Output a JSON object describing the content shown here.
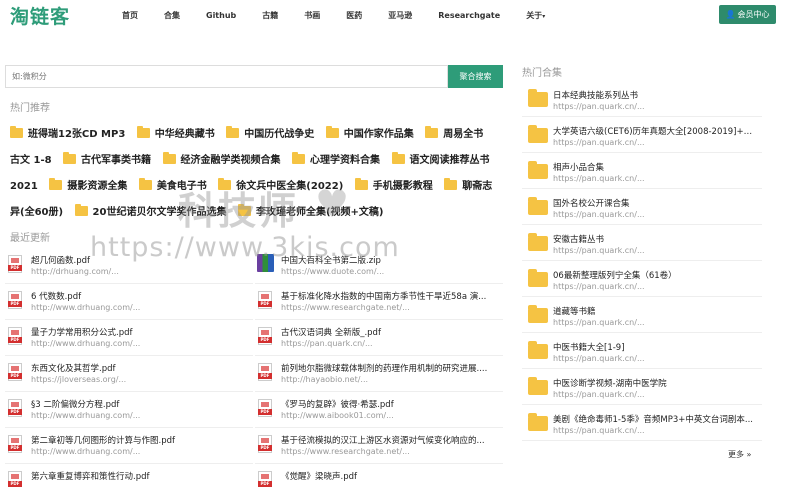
{
  "header": {
    "logo": "淘链客",
    "nav": [
      {
        "label": "首页"
      },
      {
        "label": "合集"
      },
      {
        "label": "Github"
      },
      {
        "label": "古籍"
      },
      {
        "label": "书画"
      },
      {
        "label": "医药"
      },
      {
        "label": "亚马逊"
      },
      {
        "label": "Researchgate"
      },
      {
        "label": "关于"
      }
    ],
    "vip_label": "会员中心"
  },
  "search": {
    "placeholder": "如:微积分",
    "button_label": "聚合搜索"
  },
  "hot_recommend": {
    "title": "热门推荐",
    "tags": [
      "班得瑞12张CD MP3",
      "中华经典藏书",
      "中国历代战争史",
      "中国作家作品集",
      "周易全书 古文 1-8",
      "古代军事类书籍",
      "经济金融学类视频合集",
      "心理学资料合集",
      "语文阅读推荐丛书2021",
      "摄影资源全集",
      "美食电子书",
      "徐文兵中医全集(2022)",
      "手机摄影教程",
      "聊斋志异(全60册)",
      "20世纪诺贝尔文学奖作品选集",
      "李玫瑾老师全集(视频+文稿)"
    ]
  },
  "recent": {
    "title": "最近更新",
    "items": [
      {
        "name": "超几何函数.pdf",
        "url": "http://drhuang.com/...",
        "type": "pdf"
      },
      {
        "name": "中国大百科全书第二版.zip",
        "url": "https://www.duote.com/...",
        "type": "zip"
      },
      {
        "name": "6 代数数.pdf",
        "url": "http://www.drhuang.com/...",
        "type": "pdf"
      },
      {
        "name": "基于标准化降水指数的中国南方季节性干旱近58a 演...",
        "url": "https://www.researchgate.net/...",
        "type": "pdf"
      },
      {
        "name": "量子力学常用积分公式.pdf",
        "url": "http://www.drhuang.com/...",
        "type": "pdf"
      },
      {
        "name": "古代汉语词典 全新版_.pdf",
        "url": "https://pan.quark.cn/...",
        "type": "pdf"
      },
      {
        "name": "东西文化及其哲学.pdf",
        "url": "https://jloverseas.org/...",
        "type": "pdf"
      },
      {
        "name": "前列地尔脂微球载体制剂的药理作用机制的研究进展....",
        "url": "http://hayaobio.net/...",
        "type": "pdf"
      },
      {
        "name": "§3 二阶偏微分方程.pdf",
        "url": "http://www.drhuang.com/...",
        "type": "pdf"
      },
      {
        "name": "《罗马的复辟》彼得·希瑟.pdf",
        "url": "http://www.aibook01.com/...",
        "type": "pdf"
      },
      {
        "name": "第二章初等几何图形的计算与作图.pdf",
        "url": "http://www.drhuang.com/...",
        "type": "pdf"
      },
      {
        "name": "基于径流模拟的汉江上游区水资源对气候变化响应的...",
        "url": "https://www.researchgate.net/...",
        "type": "pdf"
      },
      {
        "name": "第六章重复博弈和策性行动.pdf",
        "url": "",
        "type": "pdf"
      },
      {
        "name": "《觉醒》梁晓声.pdf",
        "url": "",
        "type": "pdf"
      }
    ]
  },
  "hot_collections": {
    "title": "热门合集",
    "items": [
      {
        "name": "日本经典技能系列丛书",
        "url": "https://pan.quark.cn/..."
      },
      {
        "name": "大学英语六级(CET6)历年真题大全[2008-2019]+真...",
        "url": "https://pan.quark.cn/..."
      },
      {
        "name": "相声小品合集",
        "url": "https://pan.quark.cn/..."
      },
      {
        "name": "国外名校公开课合集",
        "url": "https://pan.quark.cn/..."
      },
      {
        "name": "安徽古籍丛书",
        "url": "https://pan.quark.cn/..."
      },
      {
        "name": "06最新整理版列宁全集（61卷）",
        "url": "https://pan.quark.cn/..."
      },
      {
        "name": "道藏等书籍",
        "url": "https://pan.quark.cn/..."
      },
      {
        "name": "中医书籍大全[1-9]",
        "url": "https://pan.quark.cn/..."
      },
      {
        "name": "中医诊断学视频-湖南中医学院",
        "url": "https://pan.quark.cn/..."
      },
      {
        "name": "美剧《绝命毒师1-5季》音频MP3+中英文台词剧本...",
        "url": "https://pan.quark.cn/..."
      }
    ],
    "more_label": "更多 »"
  },
  "watermark": {
    "text": "科技师",
    "url": "https://www.3kjs.com"
  },
  "colors": {
    "brand": "#2e9c79",
    "folder": "#f5c343"
  }
}
